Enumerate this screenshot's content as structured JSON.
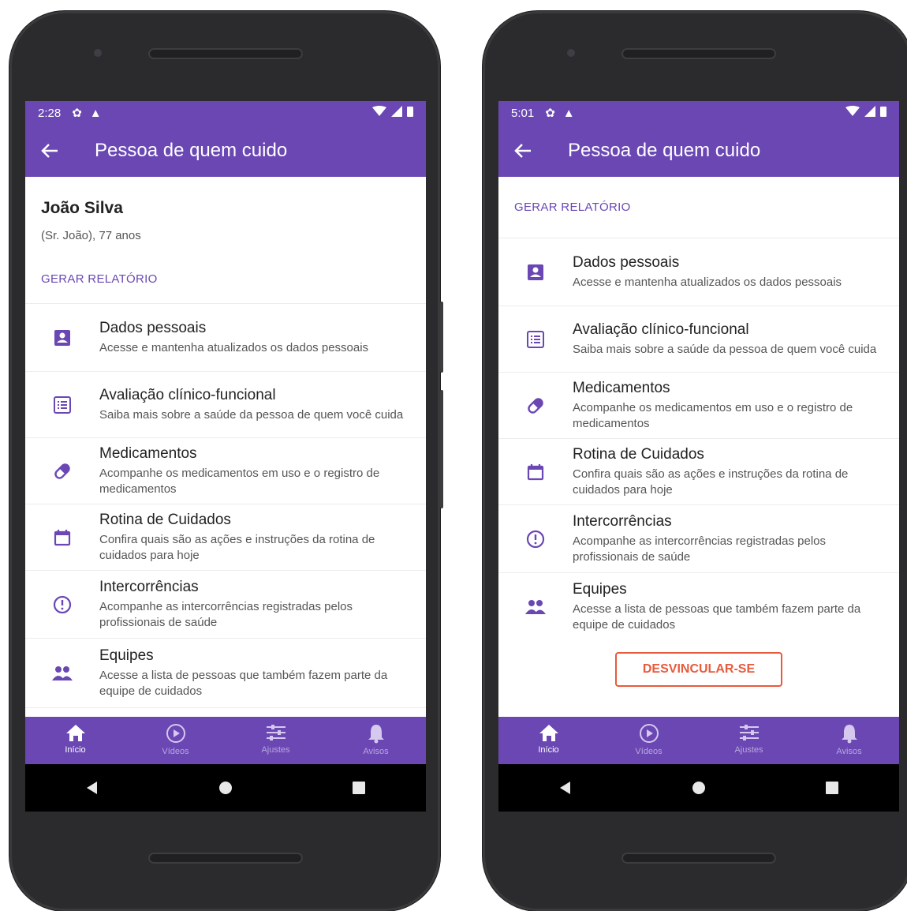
{
  "left": {
    "status": {
      "time": "2:28"
    },
    "appbar": {
      "title": "Pessoa de quem cuido"
    },
    "profile": {
      "name": "João Silva",
      "subtitle": "(Sr. João), 77 anos"
    },
    "report_label": "GERAR RELATÓRIO",
    "items": [
      {
        "title": "Dados pessoais",
        "desc": "Acesse e mantenha atualizados os dados pessoais",
        "icon": "person-card-icon"
      },
      {
        "title": "Avaliação clínico-funcional",
        "desc": "Saiba mais sobre a saúde da pessoa de quem você cuida",
        "icon": "list-icon"
      },
      {
        "title": "Medicamentos",
        "desc": "Acompanhe os medicamentos em uso e o registro de medicamentos",
        "icon": "pill-icon"
      },
      {
        "title": "Rotina de Cuidados",
        "desc": "Confira quais são as ações e instruções da rotina de cuidados para hoje",
        "icon": "calendar-icon"
      },
      {
        "title": "Intercorrências",
        "desc": "Acompanhe as intercorrências registradas pelos profissionais de saúde",
        "icon": "alert-icon"
      },
      {
        "title": "Equipes",
        "desc": "Acesse a lista de pessoas que também fazem parte da equipe de cuidados",
        "icon": "people-icon"
      }
    ],
    "nav": [
      "Início",
      "Vídeos",
      "Ajustes",
      "Avisos"
    ]
  },
  "right": {
    "status": {
      "time": "5:01"
    },
    "appbar": {
      "title": "Pessoa de quem cuido"
    },
    "report_label": "GERAR RELATÓRIO",
    "items": [
      {
        "title": "Dados pessoais",
        "desc": "Acesse e mantenha atualizados os dados pessoais",
        "icon": "person-card-icon"
      },
      {
        "title": "Avaliação clínico-funcional",
        "desc": "Saiba mais sobre a saúde da pessoa de quem você cuida",
        "icon": "list-icon"
      },
      {
        "title": "Medicamentos",
        "desc": "Acompanhe os medicamentos em uso e o registro de medicamentos",
        "icon": "pill-icon"
      },
      {
        "title": "Rotina de Cuidados",
        "desc": "Confira quais são as ações e instruções da rotina de cuidados para hoje",
        "icon": "calendar-icon"
      },
      {
        "title": "Intercorrências",
        "desc": "Acompanhe as intercorrências registradas pelos profissionais de saúde",
        "icon": "alert-icon"
      },
      {
        "title": "Equipes",
        "desc": "Acesse a lista de pessoas que também fazem parte da equipe de cuidados",
        "icon": "people-icon"
      }
    ],
    "unlink_label": "DESVINCULAR-SE",
    "nav": [
      "Início",
      "Vídeos",
      "Ajustes",
      "Avisos"
    ]
  },
  "colors": {
    "primary": "#6a47b3",
    "danger": "#e85a3c"
  }
}
